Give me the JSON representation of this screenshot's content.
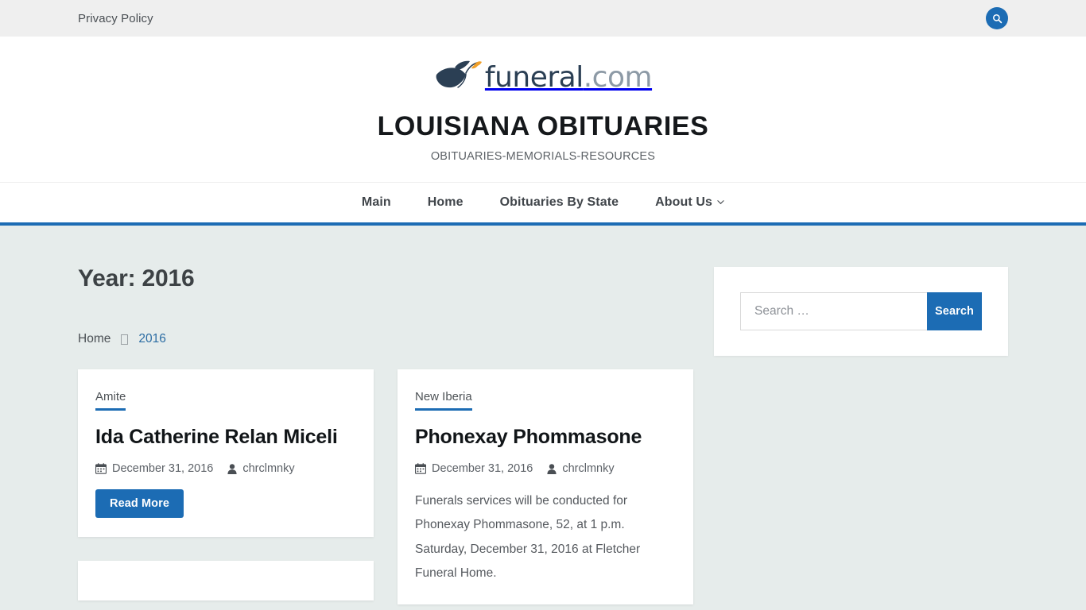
{
  "topbar": {
    "links": [
      {
        "label": "Privacy Policy"
      }
    ],
    "search_toggle_title": "Search"
  },
  "branding": {
    "logo_word": "funeral",
    "logo_tld": ".com",
    "logo_bird_color": "#2b3f54",
    "logo_leaf_color": "#f0a02a",
    "site_title": "LOUISIANA OBITUARIES",
    "tagline": "OBITUARIES-MEMORIALS-RESOURCES"
  },
  "nav": {
    "items": [
      {
        "label": "Main",
        "has_dropdown": false
      },
      {
        "label": "Home",
        "has_dropdown": false
      },
      {
        "label": "Obituaries By State",
        "has_dropdown": false
      },
      {
        "label": "About Us",
        "has_dropdown": true
      }
    ]
  },
  "main": {
    "archive_title": "Year: 2016",
    "breadcrumb": [
      {
        "label": "Home",
        "current": false
      },
      {
        "label": "2016",
        "current": true
      }
    ],
    "posts": [
      {
        "category": "Amite",
        "title": "Ida Catherine Relan Miceli",
        "date": "December 31, 2016",
        "author": "chrclmnky",
        "excerpt": "",
        "read_more_label": "Read More"
      },
      {
        "category": "New Iberia",
        "title": "Phonexay Phommasone",
        "date": "December 31, 2016",
        "author": "chrclmnky",
        "excerpt": "Funerals services will be conducted for Phonexay Phommasone, 52, at 1 p.m. Saturday, December 31, 2016 at Fletcher Funeral Home.",
        "read_more_label": ""
      }
    ]
  },
  "sidebar": {
    "search_widget": {
      "placeholder": "Search …",
      "value": "",
      "button_label": "Search"
    }
  },
  "colors": {
    "accent_blue": "#1c6cb4",
    "topbar_bg": "#efefef",
    "page_bg": "#e6eceb",
    "card_bg": "#ffffff",
    "link_blue": "#2b6ca3"
  }
}
